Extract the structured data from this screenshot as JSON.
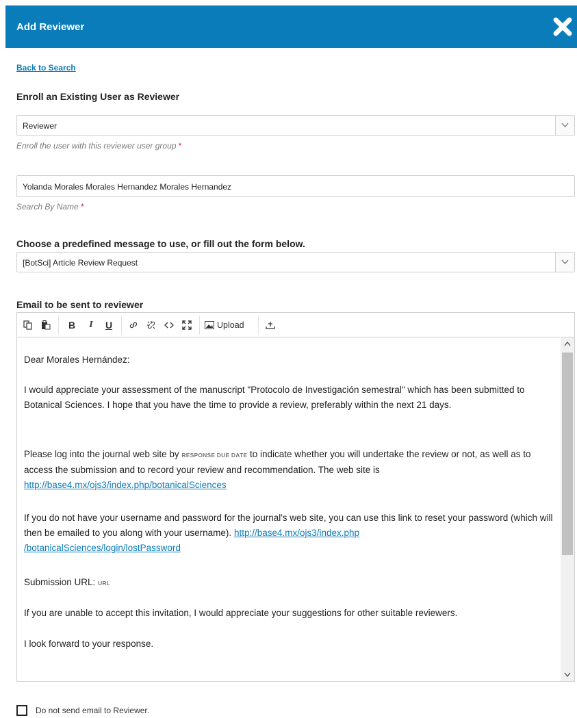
{
  "dialog": {
    "title": "Add Reviewer",
    "close_icon": "close-icon",
    "header_color": "#0a7cba"
  },
  "back_link": "Back to Search",
  "enroll": {
    "heading": "Enroll an Existing User as Reviewer",
    "group_value": "Reviewer",
    "group_hint": "Enroll the user with this reviewer user group",
    "name_value": "Yolanda Morales Morales Hernandez Morales Hernandez",
    "name_hint": "Search By Name",
    "required_mark": "*"
  },
  "template": {
    "heading": "Choose a predefined message to use, or fill out the form below.",
    "value": "[BotSci] Article Review Request"
  },
  "email": {
    "heading": "Email to be sent to reviewer",
    "toolbar": {
      "icons": [
        "copy-icon",
        "paste-icon",
        "bold-icon",
        "italic-icon",
        "underline-icon",
        "link-icon",
        "unlink-icon",
        "code-icon",
        "fullscreen-icon",
        "image-icon",
        "insert-icon"
      ],
      "bold": "B",
      "italic": "I",
      "underline": "U",
      "upload_label": "Upload"
    },
    "body": {
      "greeting": "Dear Morales Hernández:",
      "p1": "I would appreciate your assessment of the manuscript \"Protocolo de Investigación semestral\" which has been submitted to Botanical Sciences. I hope that you have the time to provide a review, preferably within the next 21 days.",
      "p2_before": "Please log into the journal web site by",
      "p2_var": "RESPONSE DUE DATE",
      "p2_after": "to indicate whether you will undertake the review or not, as well as to access the submission and to record your review and recommendation. The web site is",
      "p2_link": "http://base4.mx/ojs3/index.php/botanicalSciences",
      "p3_text": "If you do not have your username and password for the journal's web site, you can use this link to reset your password (which will then be emailed to you along with your username).",
      "p3_link_1": "http://base4.mx/ojs3/index.php",
      "p3_link_2": "/botanicalSciences/login/lostPassword",
      "p4_label": "Submission URL:",
      "p4_var": "URL",
      "p5": "If you are unable to accept this invitation, I would appreciate your suggestions for other suitable reviewers.",
      "p6": "I look forward to your response."
    }
  },
  "no_email_label": "Do not send email to Reviewer."
}
